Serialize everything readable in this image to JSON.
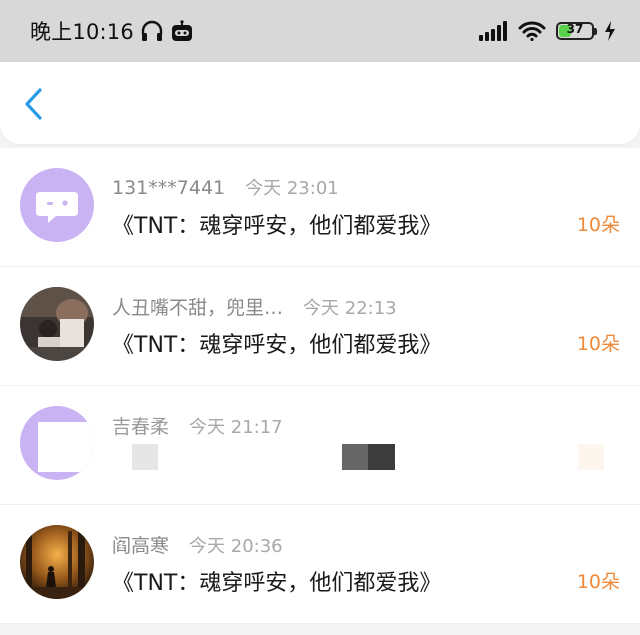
{
  "status_bar": {
    "time": "晚上10:16",
    "battery": "37",
    "battery_level": 0.37,
    "icons": [
      "headphones-icon",
      "robot-icon",
      "signal-icon",
      "wifi-icon",
      "battery-icon",
      "charging-icon"
    ]
  },
  "header": {
    "back_icon": "chevron-left-icon",
    "accent_color": "#2a9be8"
  },
  "records": [
    {
      "user": "131***7441",
      "time": "今天 23:01",
      "title": "《TNT：魂穿呼安，他们都爱我》",
      "amount": "10朵"
    },
    {
      "user": "人丑嘴不甜，兜里…",
      "time": "今天 22:13",
      "title": "《TNT：魂穿呼安，他们都爱我》",
      "amount": "10朵"
    },
    {
      "user": "吉春柔",
      "time": "今天 21:17",
      "title": "",
      "amount": ""
    },
    {
      "user": "阎高寒",
      "time": "今天 20:36",
      "title": "《TNT：魂穿呼安，他们都爱我》",
      "amount": "10朵"
    }
  ],
  "colors": {
    "amount": "#ee8a3a",
    "status_bar_bg": "#d8d8d8",
    "avatar_purple": "#c9b3f3"
  }
}
